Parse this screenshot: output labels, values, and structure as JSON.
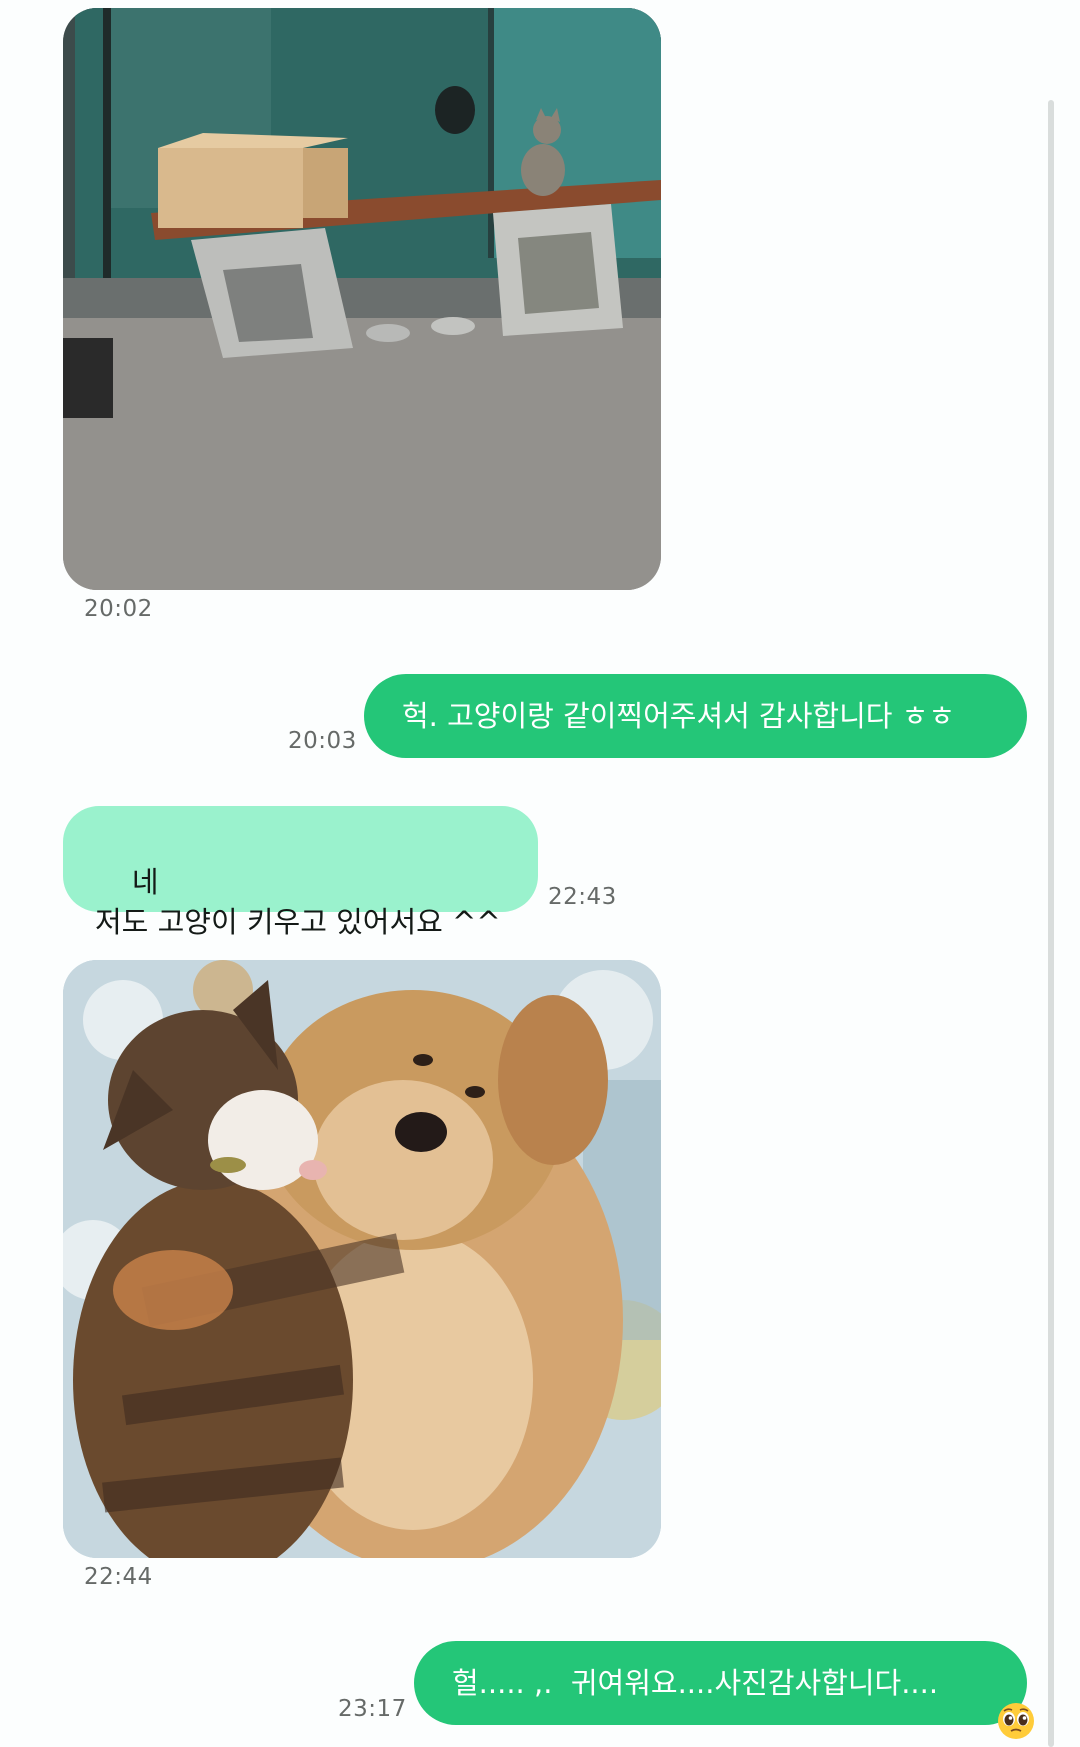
{
  "messages": [
    {
      "type": "image",
      "direction": "incoming",
      "description": "cat-on-bench-photo",
      "time": "20:02"
    },
    {
      "type": "text",
      "direction": "outgoing",
      "text": "헉. 고양이랑 같이찍어주셔서 감사합니다 ㅎㅎ",
      "time": "20:03"
    },
    {
      "type": "text",
      "direction": "incoming",
      "text": "네\n저도 고양이 키우고 있어서요 ^^",
      "time": "22:43"
    },
    {
      "type": "image",
      "direction": "incoming",
      "description": "cat-hugging-dog-photo",
      "time": "22:44"
    },
    {
      "type": "text",
      "direction": "outgoing",
      "text": "헐..... ,.  귀여워요....사진감사합니다....",
      "emoji": "pleading-face-emoji",
      "time": "23:17"
    }
  ],
  "colors": {
    "outgoing_bubble": "#24c678",
    "incoming_bubble": "#9af2cd",
    "background": "#fcfefe",
    "timestamp": "#666a68"
  }
}
